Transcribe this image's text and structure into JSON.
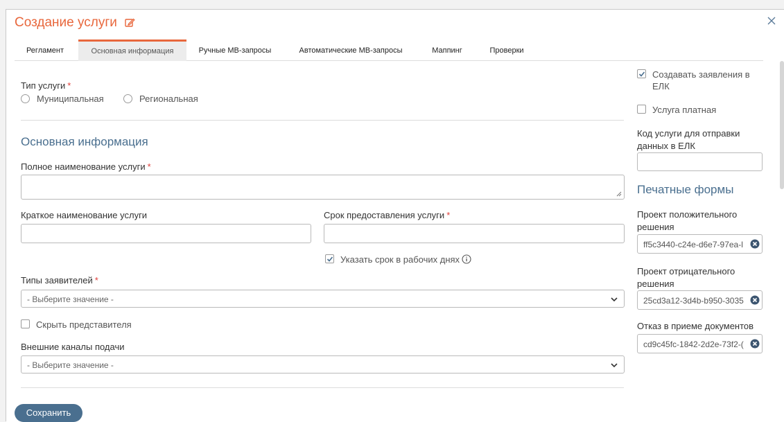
{
  "header": {
    "title": "Создание услуги"
  },
  "tabs": [
    {
      "label": "Регламент"
    },
    {
      "label": "Основная информация"
    },
    {
      "label": "Ручные МВ-запросы"
    },
    {
      "label": "Автоматические МВ-запросы"
    },
    {
      "label": "Маппинг"
    },
    {
      "label": "Проверки"
    }
  ],
  "active_tab": "Основная информация",
  "service_type": {
    "label": "Тип услуги",
    "required_mark": "*",
    "options": [
      "Муниципальная",
      "Региональная"
    ]
  },
  "main_info": {
    "section_title": "Основная информация",
    "full_name_label": "Полное наименование услуги",
    "short_name_label": "Краткое наименование услуги",
    "term_label": "Срок предоставления услуги",
    "working_days_label": "Указать срок в рабочих днях",
    "working_days_checked": true,
    "applicant_types_label": "Типы заявителей",
    "applicant_types_value": "- Выберите значение -",
    "hide_representative_label": "Скрыть представителя",
    "hide_representative_checked": false,
    "channels_label": "Внешние каналы подачи",
    "channels_value": "- Выберите значение -"
  },
  "sidebar": {
    "create_elk_label": "Создавать заявления в ЕЛК",
    "create_elk_checked": true,
    "paid_label": "Услуга платная",
    "paid_checked": false,
    "elk_code_label": "Код услуги для отправки данных в ЕЛК",
    "print_forms_title": "Печатные формы",
    "positive_label": "Проект положительного решения",
    "positive_value": "ff5c3440-c24e-d6e7-97ea-l",
    "negative_label": "Проект отрицательного решения",
    "negative_value": "25cd3a12-3d4b-b950-3035",
    "refusal_label": "Отказ в приеме документов",
    "refusal_value": "cd9c45fc-1842-2d2e-73f2-("
  },
  "footer": {
    "save_label": "Сохранить"
  },
  "colors": {
    "accent": "#e8673c",
    "primary": "#4a6f8f",
    "required": "#e0403c"
  }
}
